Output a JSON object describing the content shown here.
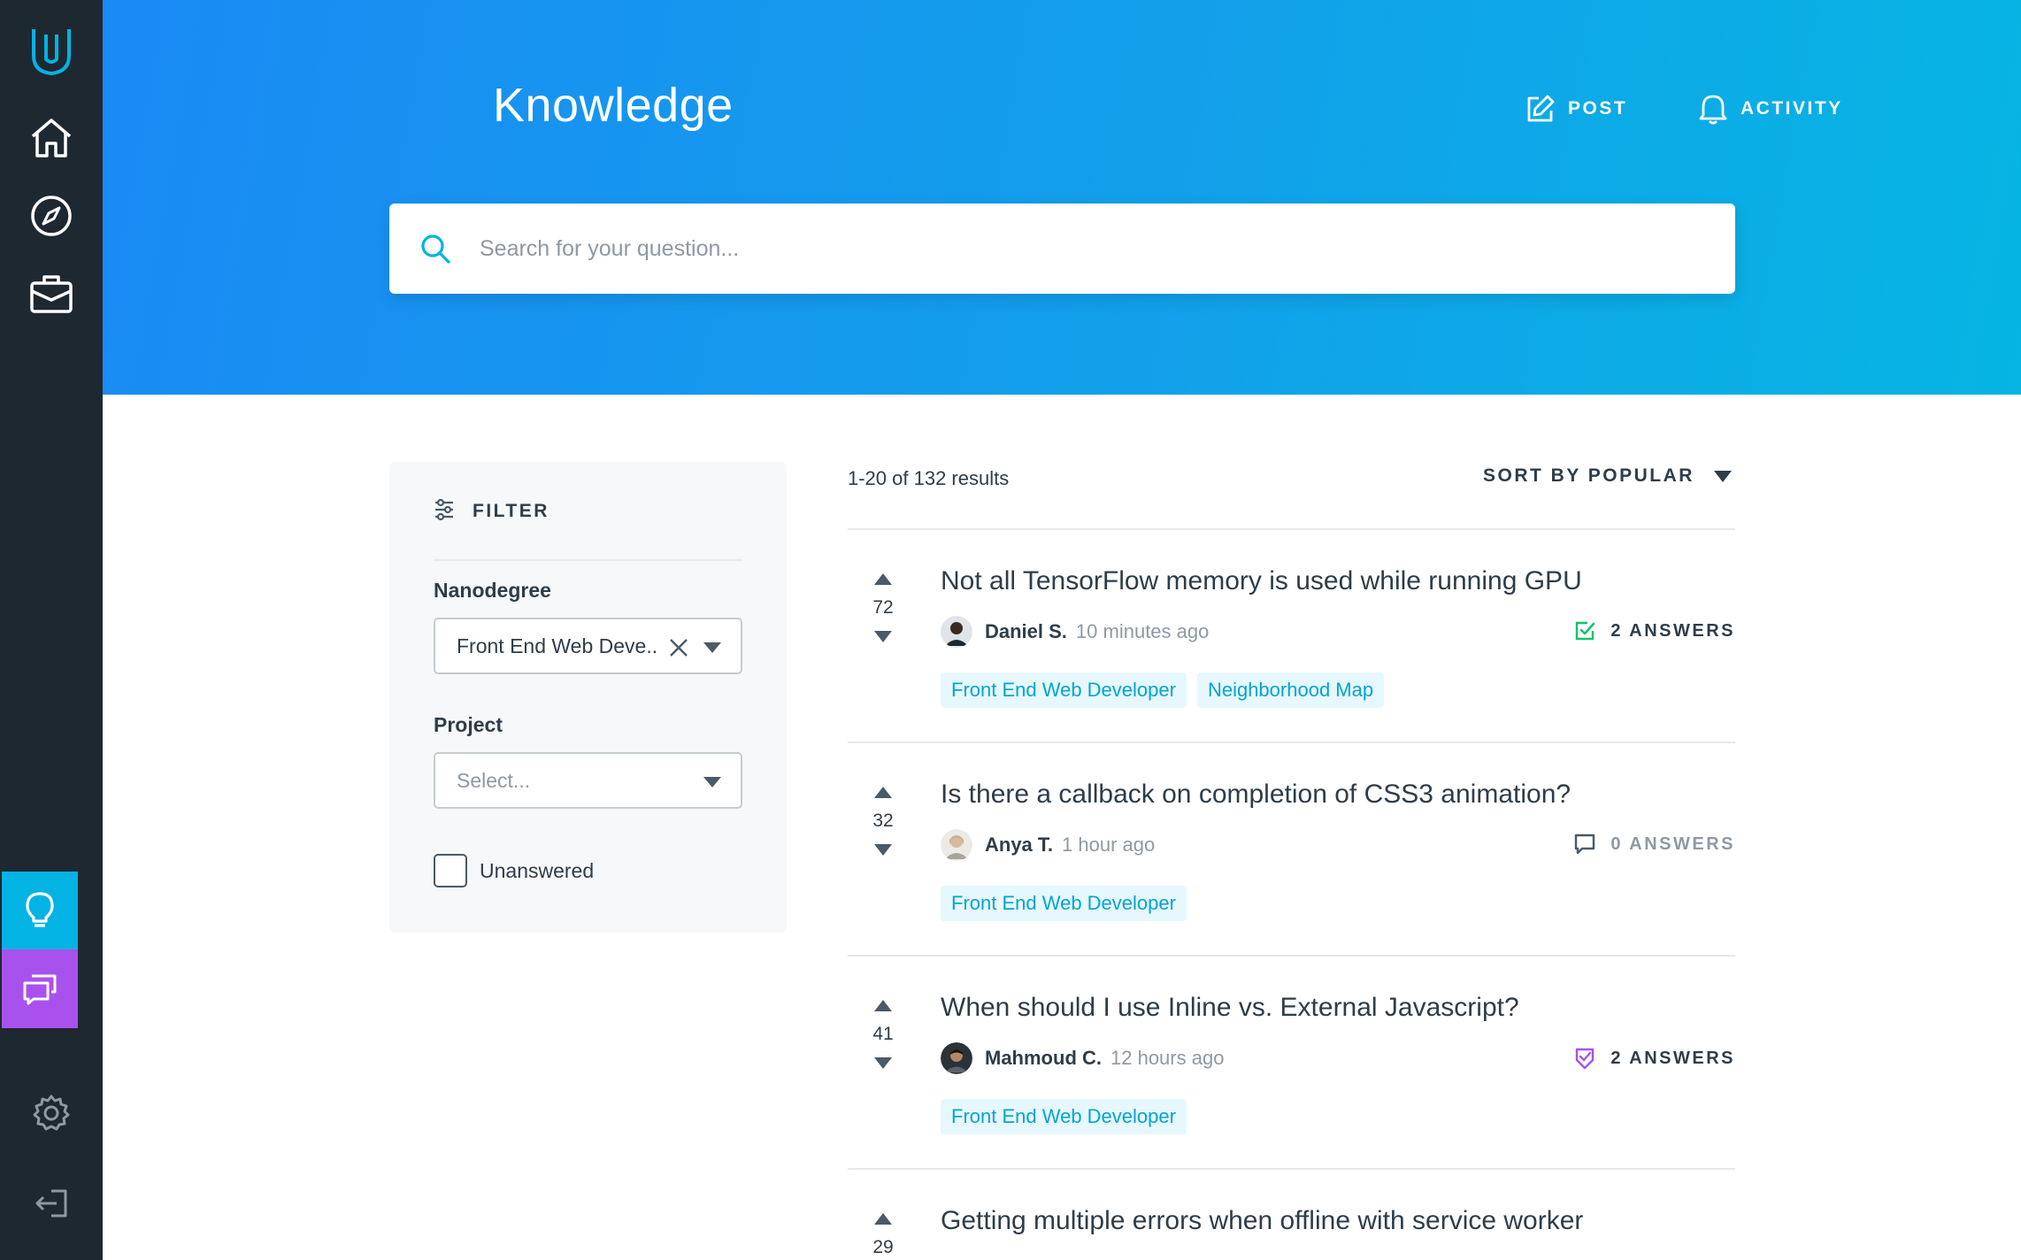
{
  "header": {
    "title": "Knowledge",
    "post_label": "POST",
    "activity_label": "ACTIVITY"
  },
  "search": {
    "placeholder": "Search for your question..."
  },
  "sidebar": {
    "items": [
      {
        "icon": "udacity-logo-icon"
      },
      {
        "icon": "home-icon"
      },
      {
        "icon": "compass-icon"
      },
      {
        "icon": "briefcase-icon"
      },
      {
        "icon": "lightbulb-icon",
        "active": true,
        "color": "#02b3e4"
      },
      {
        "icon": "chat-bubbles-icon",
        "color": "#a951ed"
      },
      {
        "icon": "gear-icon"
      },
      {
        "icon": "logout-icon"
      }
    ]
  },
  "filter": {
    "title": "FILTER",
    "nanodegree_label": "Nanodegree",
    "nanodegree_value": "Front End Web Deve...",
    "project_label": "Project",
    "project_placeholder": "Select...",
    "unanswered_label": "Unanswered"
  },
  "results": {
    "count_text": "1-20 of 132 results",
    "sort_label": "SORT BY POPULAR"
  },
  "questions": [
    {
      "votes": "72",
      "title": "Not all TensorFlow memory is used while running GPU",
      "author": "Daniel S.",
      "time": "10 minutes ago",
      "answers": "2 ANSWERS",
      "answer_icon": "checked-answer-icon",
      "answer_color": "#15c26b",
      "tags": [
        "Front End Web Developer",
        "Neighborhood Map"
      ]
    },
    {
      "votes": "32",
      "title": "Is there a callback on completion of CSS3 animation?",
      "author": "Anya T.",
      "time": "1 hour ago",
      "answers": "0 ANSWERS",
      "answer_icon": "comment-icon",
      "answer_color": "#8e99a3",
      "tags": [
        "Front End Web Developer"
      ]
    },
    {
      "votes": "41",
      "title": "When should I use Inline vs. External Javascript?",
      "author": "Mahmoud C.",
      "time": "12 hours ago",
      "answers": "2 ANSWERS",
      "answer_icon": "mentor-answer-icon",
      "answer_color": "#a951ed",
      "tags": [
        "Front End Web Developer"
      ]
    },
    {
      "votes": "29",
      "title": "Getting multiple errors when offline with service worker"
    }
  ],
  "colors": {
    "accent": "#02b3e4",
    "sidebar": "#1e2830",
    "header_gradient_start": "#1a8af5",
    "header_gradient_end": "#06b5e3"
  }
}
